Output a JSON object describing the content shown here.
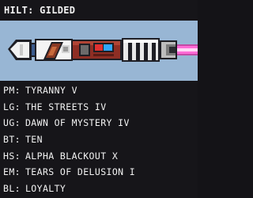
{
  "hilt": {
    "label": "HILT",
    "value": "GILDED"
  },
  "preview": {
    "blade_color": "#ff6ad6",
    "background_color": "#98b6d4",
    "icons": [
      "lightsaber-hilt-icon",
      "lightsaber-blade-icon"
    ]
  },
  "stats": [
    {
      "key": "PM",
      "value": "TYRANNY V"
    },
    {
      "key": "LG",
      "value": "THE STREETS IV"
    },
    {
      "key": "UG",
      "value": "DAWN OF MYSTERY IV"
    },
    {
      "key": "BT",
      "value": "TEN"
    },
    {
      "key": "HS",
      "value": "ALPHA BLACKOUT X"
    },
    {
      "key": "EM",
      "value": "TEARS OF DELUSION I"
    },
    {
      "key": "BL",
      "value": "LOYALTY"
    }
  ]
}
